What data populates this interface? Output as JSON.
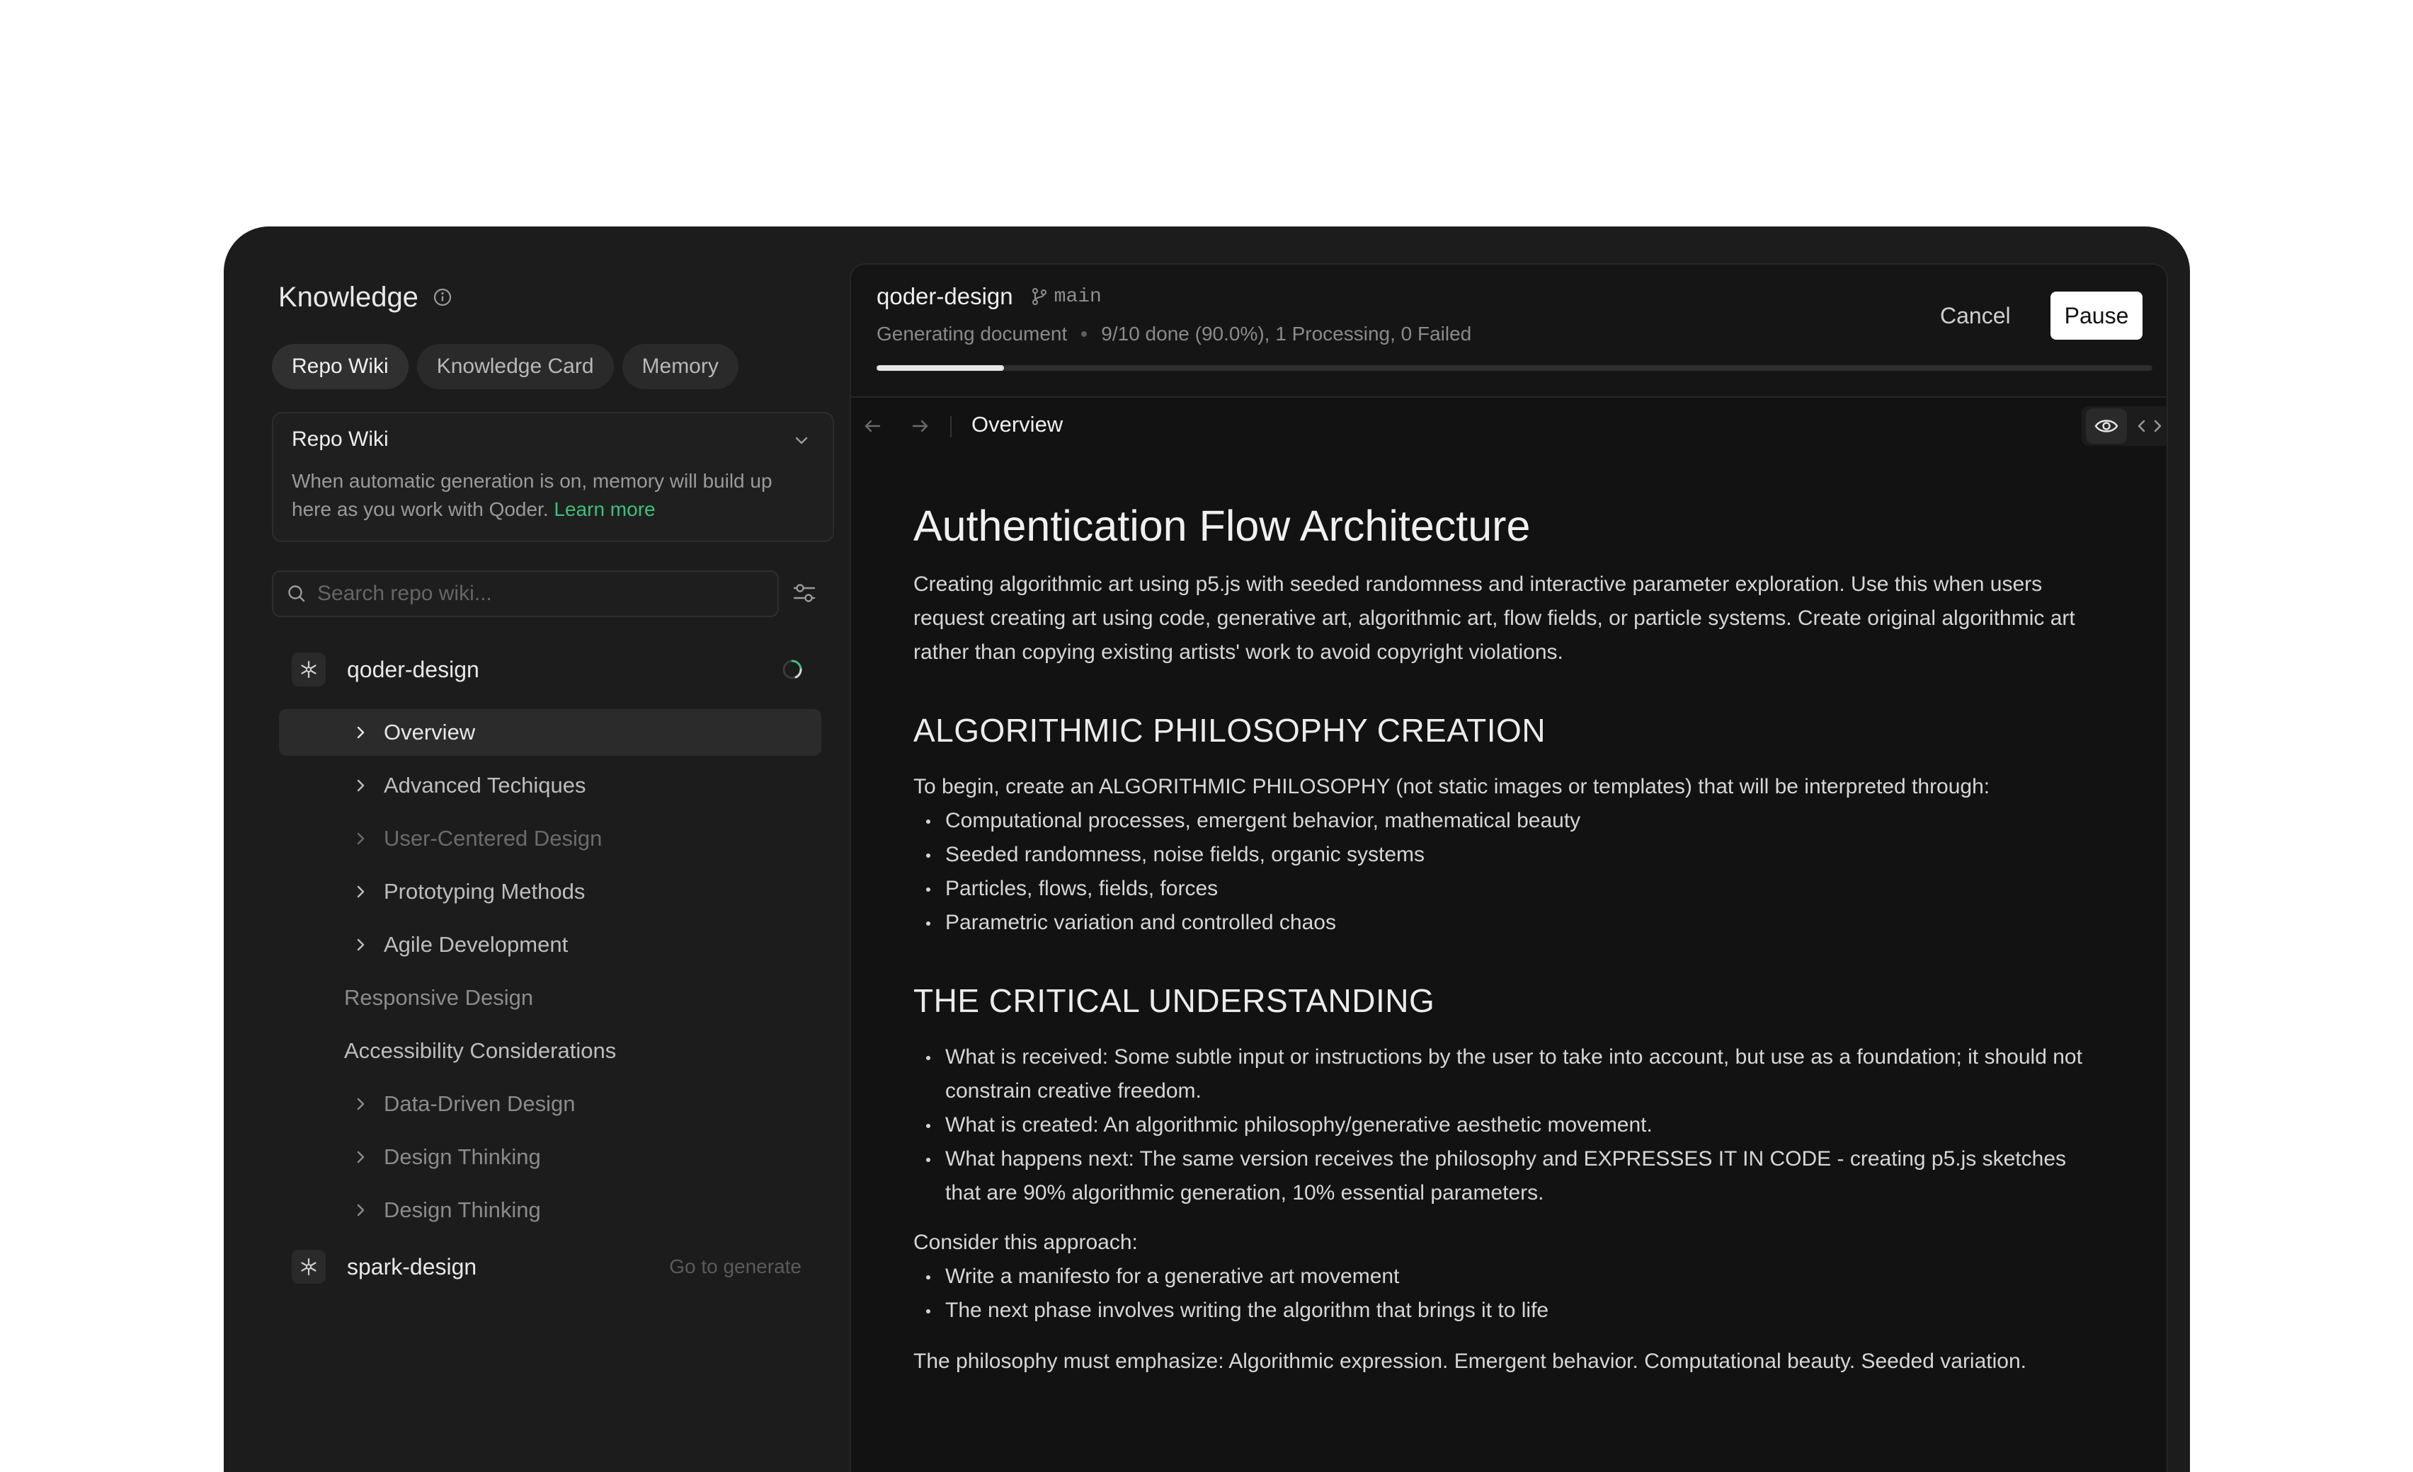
{
  "sidebar": {
    "title": "Knowledge",
    "tabs": [
      {
        "label": "Repo Wiki"
      },
      {
        "label": "Knowledge Card"
      },
      {
        "label": "Memory"
      }
    ],
    "card": {
      "title": "Repo Wiki",
      "description": "When automatic generation is on, memory will  build up here as you work with Qoder.",
      "link": "Learn more"
    },
    "search_placeholder": "Search repo wiki...",
    "repos": [
      {
        "name": "qoder-design",
        "status_icon": "loading-spinner-icon"
      },
      {
        "name": "spark-design",
        "action": "Go to generate"
      }
    ],
    "tree": [
      {
        "label": "Overview"
      },
      {
        "label": "Advanced Techiques"
      },
      {
        "label": "User-Centered Design"
      },
      {
        "label": "Prototyping Methods"
      },
      {
        "label": "Agile Development"
      },
      {
        "label": "Responsive Design"
      },
      {
        "label": "Accessibility Considerations"
      },
      {
        "label": "Data-Driven Design"
      },
      {
        "label": "Design Thinking"
      },
      {
        "label": "Design Thinking"
      }
    ]
  },
  "doc": {
    "project": "qoder-design",
    "branch": "main",
    "status_label": "Generating document",
    "status_detail": "9/10 done (90.0%), 1 Processing, 0 Failed",
    "progress": 0.1,
    "cancel_label": "Cancel",
    "pause_label": "Pause",
    "breadcrumb": "Overview",
    "title": "Authentication Flow Architecture",
    "intro": "Creating algorithmic art using p5.js with seeded randomness and interactive parameter exploration. Use this when users request creating art using code, generative art, algorithmic art, flow fields, or particle systems. Create original algorithmic art rather than copying existing artists' work to avoid copyright violations.",
    "section1": {
      "heading": "ALGORITHMIC PHILOSOPHY CREATION",
      "lead": "To begin, create an ALGORITHMIC PHILOSOPHY (not static images or templates) that will be interpreted through:",
      "bullets": [
        "Computational processes, emergent behavior, mathematical beauty",
        "Seeded randomness, noise fields, organic systems",
        "Particles, flows, fields, forces",
        "Parametric variation and controlled chaos"
      ]
    },
    "section2": {
      "heading": "THE CRITICAL UNDERSTANDING",
      "bullets": [
        "What is received: Some subtle input or instructions by the user to take into account, but use as a foundation; it should not constrain creative freedom.",
        "What is created: An algorithmic philosophy/generative aesthetic movement.",
        "What happens next: The same version receives the philosophy and EXPRESSES IT IN CODE - creating p5.js sketches that are 90% algorithmic generation, 10% essential parameters."
      ],
      "approach_lead": "Consider this approach:",
      "approach_bullets": [
        "Write a manifesto for a generative art movement",
        "The next phase involves writing the algorithm that brings it to life"
      ],
      "closing": "The philosophy must emphasize: Algorithmic expression. Emergent behavior. Computational beauty. Seeded variation."
    }
  }
}
